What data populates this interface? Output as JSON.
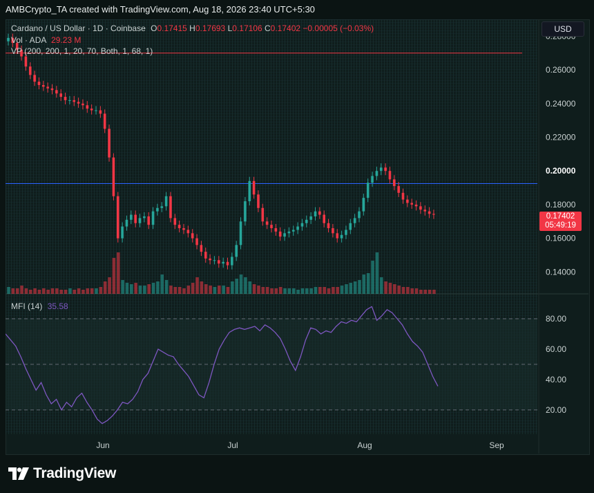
{
  "header": {
    "attribution": "AMBCrypto_TA created with TradingView.com, Aug 18, 2026 23:40 UTC+5:30"
  },
  "legend": {
    "symbol": "Cardano / US Dollar · 1D · Coinbase",
    "open_label": "O",
    "open": "0.17415",
    "high_label": "H",
    "high": "0.17693",
    "low_label": "L",
    "low": "0.17106",
    "close_label": "C",
    "close": "0.17402",
    "change": "−0.00005 (−0.03%)",
    "volume_label": "Vol · ADA",
    "volume": "29.23 M",
    "vp_label": "VP (200, 200, 1, 20, 70, Both, 1, 68, 1)",
    "mfi_label": "MFI (14)",
    "mfi": "35.58"
  },
  "currency": "USD",
  "last_price": "0.17402",
  "countdown": "05:49:19",
  "colors": {
    "up": "#26a69a",
    "down": "#f23645",
    "mfi": "#7e57c2",
    "hline_blue": "#2962ff",
    "hline_red": "#f23645"
  },
  "logo_text": "TradingView",
  "chart_data": [
    {
      "type": "candlestick",
      "title": "Cardano / US Dollar · 1D · Coinbase",
      "y_ticks": [
        "0.28000",
        "0.26000",
        "0.24000",
        "0.22000",
        "0.20000",
        "0.18000",
        "0.16000",
        "0.14000"
      ],
      "ylim": [
        0.127,
        0.29
      ],
      "x_ticks": [
        "Jun",
        "Jul",
        "Aug",
        "Sep"
      ],
      "horizontal_lines": [
        0.27,
        0.1925
      ],
      "close_series": [
        0.279,
        0.276,
        0.272,
        0.268,
        0.262,
        0.257,
        0.253,
        0.251,
        0.25,
        0.249,
        0.248,
        0.246,
        0.244,
        0.242,
        0.242,
        0.241,
        0.24,
        0.239,
        0.237,
        0.236,
        0.236,
        0.234,
        0.225,
        0.208,
        0.185,
        0.16,
        0.167,
        0.171,
        0.174,
        0.169,
        0.172,
        0.173,
        0.168,
        0.176,
        0.178,
        0.179,
        0.185,
        0.172,
        0.168,
        0.166,
        0.165,
        0.163,
        0.16,
        0.156,
        0.152,
        0.148,
        0.147,
        0.147,
        0.145,
        0.146,
        0.144,
        0.149,
        0.156,
        0.17,
        0.182,
        0.194,
        0.186,
        0.178,
        0.17,
        0.168,
        0.166,
        0.164,
        0.161,
        0.163,
        0.164,
        0.165,
        0.167,
        0.169,
        0.171,
        0.173,
        0.176,
        0.174,
        0.169,
        0.166,
        0.163,
        0.16,
        0.162,
        0.165,
        0.169,
        0.172,
        0.176,
        0.184,
        0.193,
        0.197,
        0.2,
        0.202,
        0.2,
        0.195,
        0.191,
        0.187,
        0.183,
        0.181,
        0.18,
        0.179,
        0.177,
        0.176,
        0.1745,
        0.174
      ],
      "volume": {
        "label": "Vol · ADA",
        "values": [
          5,
          4,
          4,
          6,
          4,
          3,
          4,
          3,
          4,
          3,
          4,
          4,
          3,
          3,
          4,
          3,
          4,
          3,
          4,
          4,
          4,
          5,
          9,
          12,
          26,
          30,
          10,
          8,
          7,
          8,
          6,
          6,
          7,
          8,
          9,
          14,
          10,
          6,
          5,
          5,
          4,
          6,
          8,
          12,
          9,
          7,
          6,
          5,
          6,
          6,
          5,
          9,
          11,
          14,
          12,
          9,
          7,
          6,
          5,
          5,
          4,
          4,
          5,
          4,
          4,
          4,
          3,
          4,
          4,
          4,
          5,
          5,
          5,
          4,
          5,
          5,
          6,
          7,
          8,
          9,
          10,
          14,
          15,
          24,
          30,
          12,
          9,
          8,
          7,
          6,
          5,
          5,
          4,
          4,
          3,
          3,
          3,
          3
        ]
      }
    },
    {
      "type": "line",
      "title": "MFI (14)",
      "y_ticks": [
        "80.00",
        "60.00",
        "40.00",
        "20.00"
      ],
      "ylim": [
        4,
        95
      ],
      "bands": [
        80,
        50,
        20
      ],
      "values": [
        70,
        66,
        62,
        55,
        47,
        40,
        33,
        38,
        30,
        24,
        27,
        20,
        25,
        22,
        28,
        31,
        25,
        20,
        14,
        11,
        13,
        16,
        20,
        25,
        24,
        27,
        32,
        40,
        44,
        52,
        60,
        58,
        56,
        55,
        50,
        46,
        42,
        36,
        30,
        28,
        38,
        50,
        60,
        66,
        71,
        73,
        74,
        73,
        74,
        75,
        72,
        76,
        74,
        71,
        67,
        60,
        52,
        46,
        55,
        66,
        74,
        73,
        70,
        72,
        71,
        75,
        78,
        77,
        79,
        78,
        82,
        86,
        88,
        79,
        82,
        86,
        84,
        80,
        76,
        70,
        65,
        62,
        58,
        50,
        42,
        35.58
      ]
    }
  ]
}
